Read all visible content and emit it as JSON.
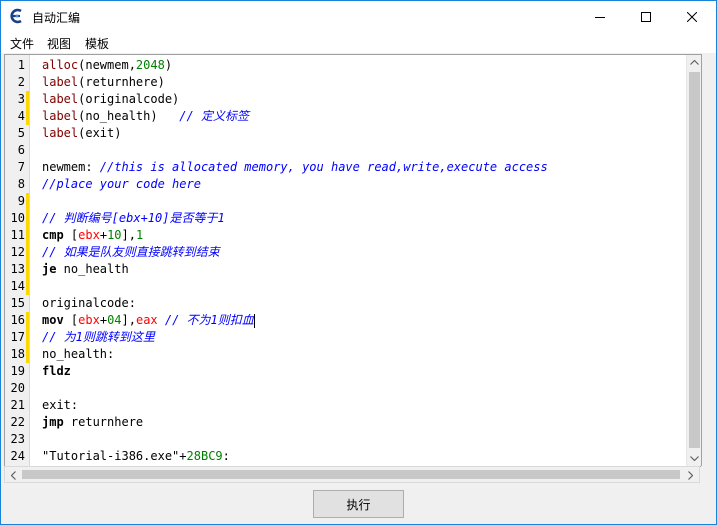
{
  "window": {
    "title": "自动汇编",
    "icon": "cheat-engine-icon",
    "controls": [
      "minimize-icon",
      "maximize-icon",
      "close-icon"
    ],
    "accent_color": "#1883d7"
  },
  "menu": {
    "items": [
      {
        "label": "文件"
      },
      {
        "label": "视图"
      },
      {
        "label": "模板"
      }
    ]
  },
  "editor": {
    "colors": {
      "keyword": "#000000",
      "label_keyword": "#800000",
      "comment": "#0000ff",
      "number": "#008000",
      "register": "#ff0000",
      "change_marker": "#ffd700"
    },
    "lines": [
      {
        "number": "1",
        "changed": false,
        "tokens": [
          {
            "t": "alloc",
            "c": "kwn"
          },
          {
            "t": "(newmem,",
            "c": "plain"
          },
          {
            "t": "2048",
            "c": "num"
          },
          {
            "t": ")",
            "c": "plain"
          }
        ]
      },
      {
        "number": "2",
        "changed": false,
        "tokens": [
          {
            "t": "label",
            "c": "kwn"
          },
          {
            "t": "(returnhere)",
            "c": "plain"
          }
        ]
      },
      {
        "number": "3",
        "changed": true,
        "tokens": [
          {
            "t": "label",
            "c": "kwn"
          },
          {
            "t": "(originalcode)",
            "c": "plain"
          }
        ]
      },
      {
        "number": "4",
        "changed": true,
        "tokens": [
          {
            "t": "label",
            "c": "kwn"
          },
          {
            "t": "(no_health)   ",
            "c": "plain"
          },
          {
            "t": "// 定义标签",
            "c": "cmt"
          }
        ]
      },
      {
        "number": "5",
        "changed": false,
        "tokens": [
          {
            "t": "label",
            "c": "kwn"
          },
          {
            "t": "(exit)",
            "c": "plain"
          }
        ]
      },
      {
        "number": "6",
        "changed": false,
        "tokens": []
      },
      {
        "number": "7",
        "changed": false,
        "tokens": [
          {
            "t": "newmem: ",
            "c": "plain"
          },
          {
            "t": "//this is allocated memory, you have read,write,execute access",
            "c": "cmt"
          }
        ]
      },
      {
        "number": "8",
        "changed": false,
        "tokens": [
          {
            "t": "//place your code here",
            "c": "cmt"
          }
        ]
      },
      {
        "number": "9",
        "changed": true,
        "tokens": []
      },
      {
        "number": "10",
        "changed": true,
        "tokens": [
          {
            "t": "// 判断编号[ebx+10]是否等于1",
            "c": "cmt"
          }
        ]
      },
      {
        "number": "11",
        "changed": true,
        "tokens": [
          {
            "t": "cmp",
            "c": "kw"
          },
          {
            "t": " [",
            "c": "plain"
          },
          {
            "t": "ebx",
            "c": "reg"
          },
          {
            "t": "+",
            "c": "plain"
          },
          {
            "t": "10",
            "c": "num"
          },
          {
            "t": "],",
            "c": "plain"
          },
          {
            "t": "1",
            "c": "num"
          }
        ]
      },
      {
        "number": "12",
        "changed": true,
        "tokens": [
          {
            "t": "// 如果是队友则直接跳转到结束",
            "c": "cmt"
          }
        ]
      },
      {
        "number": "13",
        "changed": true,
        "tokens": [
          {
            "t": "je",
            "c": "kw"
          },
          {
            "t": " no_health",
            "c": "plain"
          }
        ]
      },
      {
        "number": "14",
        "changed": true,
        "tokens": []
      },
      {
        "number": "15",
        "changed": false,
        "tokens": [
          {
            "t": "originalcode:",
            "c": "plain"
          }
        ]
      },
      {
        "number": "16",
        "changed": true,
        "tokens": [
          {
            "t": "mov",
            "c": "kw"
          },
          {
            "t": " [",
            "c": "plain"
          },
          {
            "t": "ebx",
            "c": "reg"
          },
          {
            "t": "+",
            "c": "plain"
          },
          {
            "t": "04",
            "c": "num"
          },
          {
            "t": "],",
            "c": "plain"
          },
          {
            "t": "eax",
            "c": "reg"
          },
          {
            "t": " // 不为1则扣血",
            "c": "cmt"
          }
        ],
        "caret": true
      },
      {
        "number": "17",
        "changed": true,
        "tokens": [
          {
            "t": "// 为1则跳转到这里",
            "c": "cmt"
          }
        ]
      },
      {
        "number": "18",
        "changed": true,
        "tokens": [
          {
            "t": "no_health:",
            "c": "plain"
          }
        ]
      },
      {
        "number": "19",
        "changed": false,
        "tokens": [
          {
            "t": "fldz",
            "c": "kw"
          }
        ]
      },
      {
        "number": "20",
        "changed": false,
        "tokens": []
      },
      {
        "number": "21",
        "changed": false,
        "tokens": [
          {
            "t": "exit:",
            "c": "plain"
          }
        ]
      },
      {
        "number": "22",
        "changed": false,
        "tokens": [
          {
            "t": "jmp",
            "c": "kw"
          },
          {
            "t": " returnhere",
            "c": "plain"
          }
        ]
      },
      {
        "number": "23",
        "changed": false,
        "tokens": []
      },
      {
        "number": "24",
        "changed": false,
        "tokens": [
          {
            "t": "\"Tutorial-i386.exe\"",
            "c": "str"
          },
          {
            "t": "+",
            "c": "plain"
          },
          {
            "t": "28BC9",
            "c": "num"
          },
          {
            "t": ":",
            "c": "plain"
          }
        ]
      }
    ]
  },
  "footer": {
    "execute_label": "执行"
  }
}
